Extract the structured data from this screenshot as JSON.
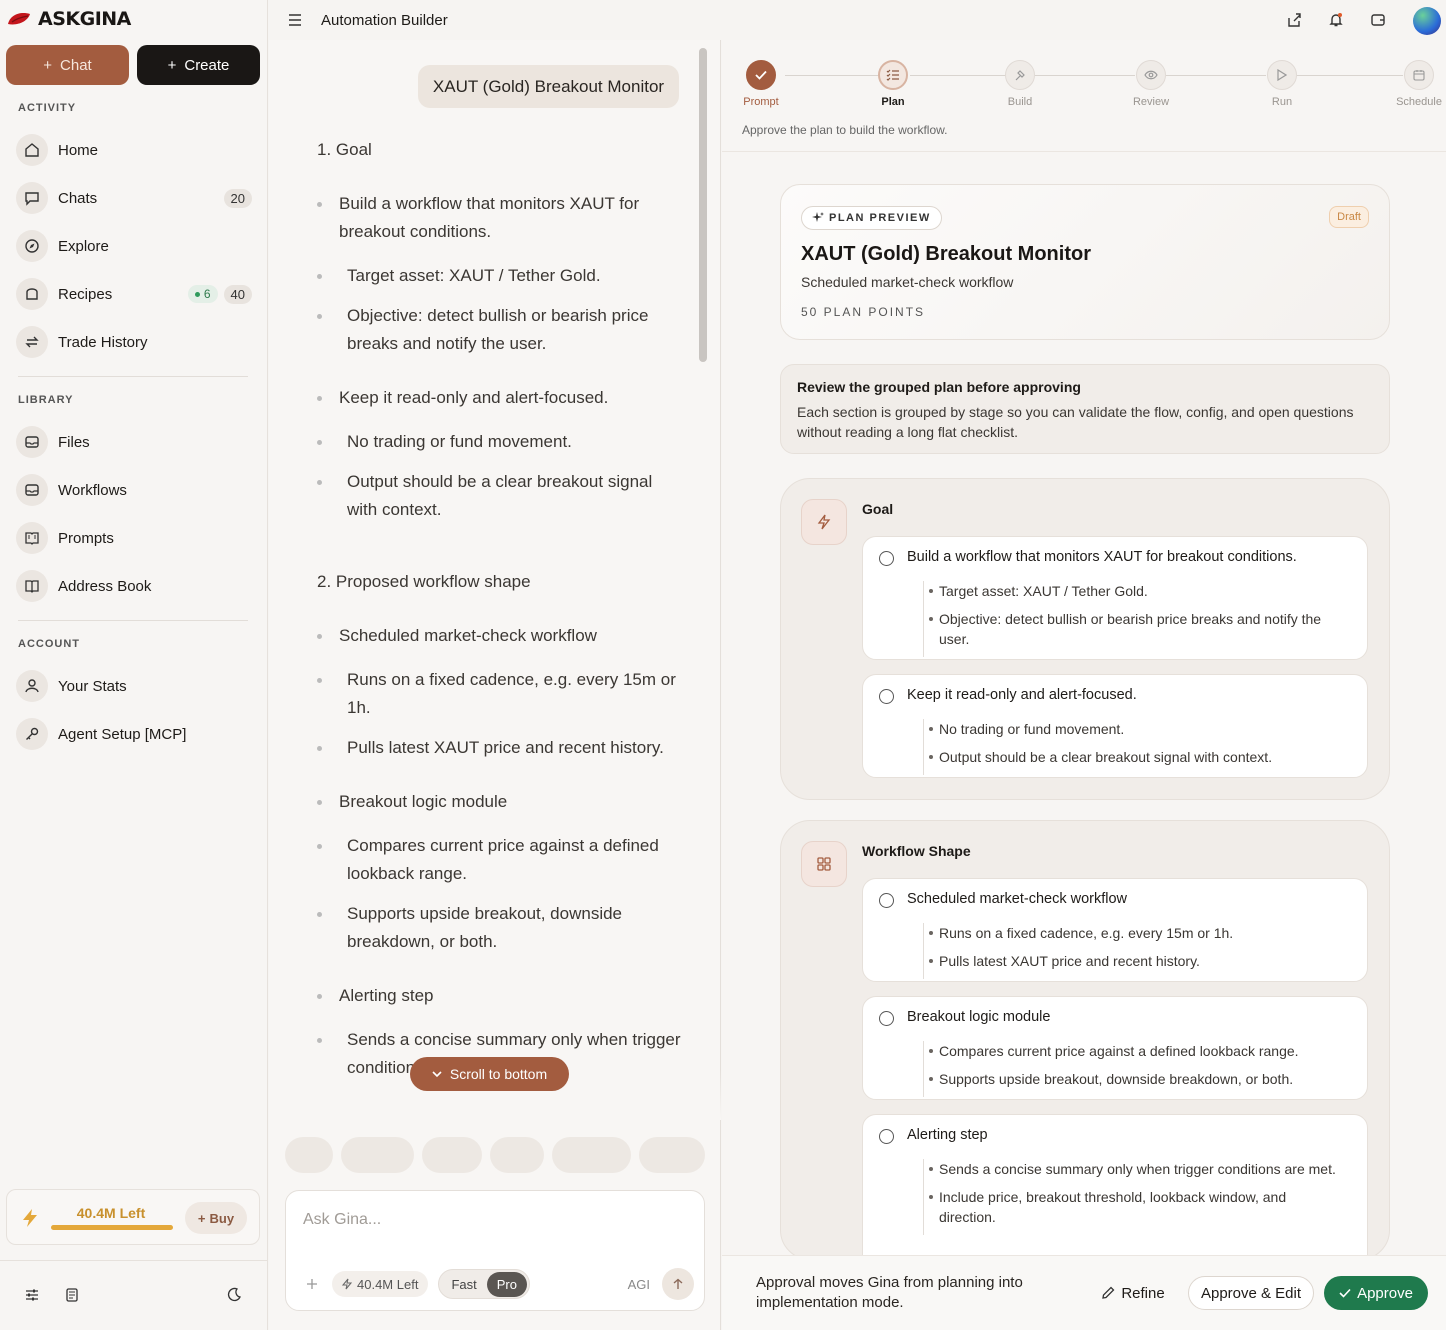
{
  "app": {
    "logo_text": "ASKGINA",
    "header_title": "Automation Builder"
  },
  "sidebar": {
    "chat_label": "Chat",
    "create_label": "Create",
    "activity_label": "ACTIVITY",
    "library_label": "LIBRARY",
    "account_label": "ACCOUNT",
    "activity": [
      {
        "label": "Home",
        "icon": "home-icon"
      },
      {
        "label": "Chats",
        "badge": "20",
        "icon": "chat-icon"
      },
      {
        "label": "Explore",
        "icon": "compass-icon"
      },
      {
        "label": "Recipes",
        "badge_dot": "6",
        "badge": "40",
        "icon": "recipe-icon"
      },
      {
        "label": "Trade History",
        "icon": "swap-icon"
      }
    ],
    "library": [
      {
        "label": "Files"
      },
      {
        "label": "Workflows"
      },
      {
        "label": "Prompts"
      },
      {
        "label": "Address Book"
      }
    ],
    "account": [
      {
        "label": "Your Stats"
      },
      {
        "label": "Agent Setup [MCP]"
      }
    ],
    "credits": {
      "left": "40.4M Left",
      "buy": "Buy",
      "fill_fraction": 1.0
    }
  },
  "chat": {
    "user_message": "XAUT (Gold) Breakout Monitor",
    "scroll_to_bottom": "Scroll to bottom",
    "composer_placeholder": "Ask Gina...",
    "credits": "40.4M Left",
    "mode_fast": "Fast",
    "mode_pro": "Pro",
    "agi": "AGI",
    "lines": {
      "h1": "1. Goal",
      "g1": "Build a workflow that monitors XAUT for breakout conditions.",
      "g1a": "Target asset: XAUT / Tether Gold.",
      "g1b": "Objective: detect bullish or bearish price breaks and notify the user.",
      "g2": "Keep it read-only and alert-focused.",
      "g2a": "No trading or fund movement.",
      "g2b": "Output should be a clear breakout signal with context.",
      "h2": "2. Proposed workflow shape",
      "w1": "Scheduled market-check workflow",
      "w1a": "Runs on a fixed cadence, e.g. every 15m or 1h.",
      "w1b": "Pulls latest XAUT price and recent history.",
      "w2": "Breakout logic module",
      "w2a": "Compares current price against a defined lookback range.",
      "w2b": "Supports upside breakout, downside breakdown, or both.",
      "w3": "Alerting step",
      "w3a": "Sends a concise summary only when trigger conditions are met."
    }
  },
  "plan": {
    "steps": [
      "Prompt",
      "Plan",
      "Build",
      "Review",
      "Run",
      "Schedule"
    ],
    "hint": "Approve the plan to build the workflow.",
    "preview_tag": "PLAN PREVIEW",
    "draft": "Draft",
    "title": "XAUT (Gold) Breakout Monitor",
    "subtitle": "Scheduled market-check workflow",
    "points": "50 PLAN POINTS",
    "review_title": "Review the grouped plan before approving",
    "review_body": "Each section is grouped by stage so you can validate the flow, config, and open questions without reading a long flat checklist.",
    "goal_title": "Goal",
    "goal_items": [
      {
        "title": "Build a workflow that monitors XAUT for breakout conditions.",
        "subs": [
          "Target asset: XAUT / Tether Gold.",
          "Objective: detect bullish or bearish price breaks and notify the user."
        ]
      },
      {
        "title": "Keep it read-only and alert-focused.",
        "subs": [
          "No trading or fund movement.",
          "Output should be a clear breakout signal with context."
        ]
      }
    ],
    "shape_title": "Workflow Shape",
    "shape_items": [
      {
        "title": "Scheduled market-check workflow",
        "subs": [
          "Runs on a fixed cadence, e.g. every 15m or 1h.",
          "Pulls latest XAUT price and recent history."
        ]
      },
      {
        "title": "Breakout logic module",
        "subs": [
          "Compares current price against a defined lookback range.",
          "Supports upside breakout, downside breakdown, or both."
        ]
      },
      {
        "title": "Alerting step",
        "subs": [
          "Sends a concise summary only when trigger conditions are met.",
          "Include price, breakout threshold, lookback window, and direction."
        ]
      }
    ],
    "footer_text": "Approval moves Gina from planning into implementation mode.",
    "refine": "Refine",
    "approve_edit": "Approve & Edit",
    "approve": "Approve"
  },
  "colors": {
    "accent": "#a35c3f",
    "approve_green": "#1f7a4d",
    "credits_yellow": "#e4a83a"
  }
}
